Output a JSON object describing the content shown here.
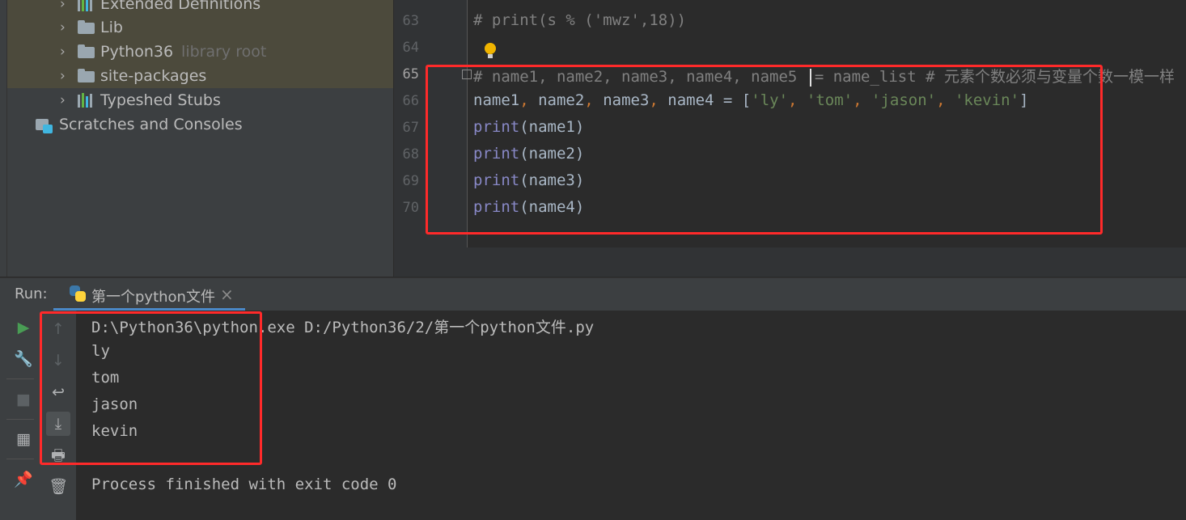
{
  "project_tree": {
    "items": [
      {
        "label": "Extended Definitions",
        "hint": "",
        "icon": "library-icon",
        "expandable": true
      },
      {
        "label": "Lib",
        "hint": "",
        "icon": "folder-icon",
        "expandable": true
      },
      {
        "label": "Python36",
        "hint": "library root",
        "icon": "folder-icon",
        "expandable": true
      },
      {
        "label": "site-packages",
        "hint": "",
        "icon": "folder-icon",
        "expandable": true
      },
      {
        "label": "Typeshed Stubs",
        "hint": "",
        "icon": "library-icon",
        "expandable": true
      },
      {
        "label": "Scratches and Consoles",
        "hint": "",
        "icon": "scratches-icon",
        "expandable": false
      }
    ]
  },
  "editor": {
    "line_numbers": [
      "63",
      "64",
      "65",
      "66",
      "67",
      "68",
      "69",
      "70"
    ],
    "current_line": "65",
    "lines": {
      "l63": "# print(s % ('mwz',18))",
      "l65_before_caret": "# name1, name2, name3, name4, name5 ",
      "l65_after_caret": "= name_list # 元素个数必须与变量个数一模一样",
      "l66": {
        "vars": "name1",
        "sep1": ", ",
        "v2": "name2",
        "sep2": ", ",
        "v3": "name3",
        "sep3": ", ",
        "v4": "name4",
        "assign": " = [",
        "s1": "'ly'",
        "c1": ", ",
        "s2": "'tom'",
        "c2": ", ",
        "s3": "'jason'",
        "c3": ", ",
        "s4": "'kevin'",
        "close": "]"
      },
      "l67": {
        "fn": "print",
        "args": "(name1)"
      },
      "l68": {
        "fn": "print",
        "args": "(name2)"
      },
      "l69": {
        "fn": "print",
        "args": "(name3)"
      },
      "l70": {
        "fn": "print",
        "args": "(name4)"
      }
    }
  },
  "run_window": {
    "label": "Run:",
    "tab_label": "第一个python文件",
    "close_glyph": "×",
    "console_lines": [
      "D:\\Python36\\python.exe D:/Python36/2/第一个python文件.py",
      "ly",
      "tom",
      "jason",
      "kevin",
      "",
      "Process finished with exit code 0"
    ]
  },
  "icons": {
    "run": "▶",
    "wrench": "🔧",
    "stop": "■",
    "layout": "▦",
    "pin": "📌",
    "up": "↑",
    "down": "↓",
    "wrap": "↩",
    "scroll_end": "⤓",
    "print": "🖶",
    "trash": "🗑"
  },
  "colors": {
    "annotation_box": "#ff2a2a",
    "keyword": "#8888c6",
    "string": "#6a8759",
    "comment": "#808080"
  }
}
